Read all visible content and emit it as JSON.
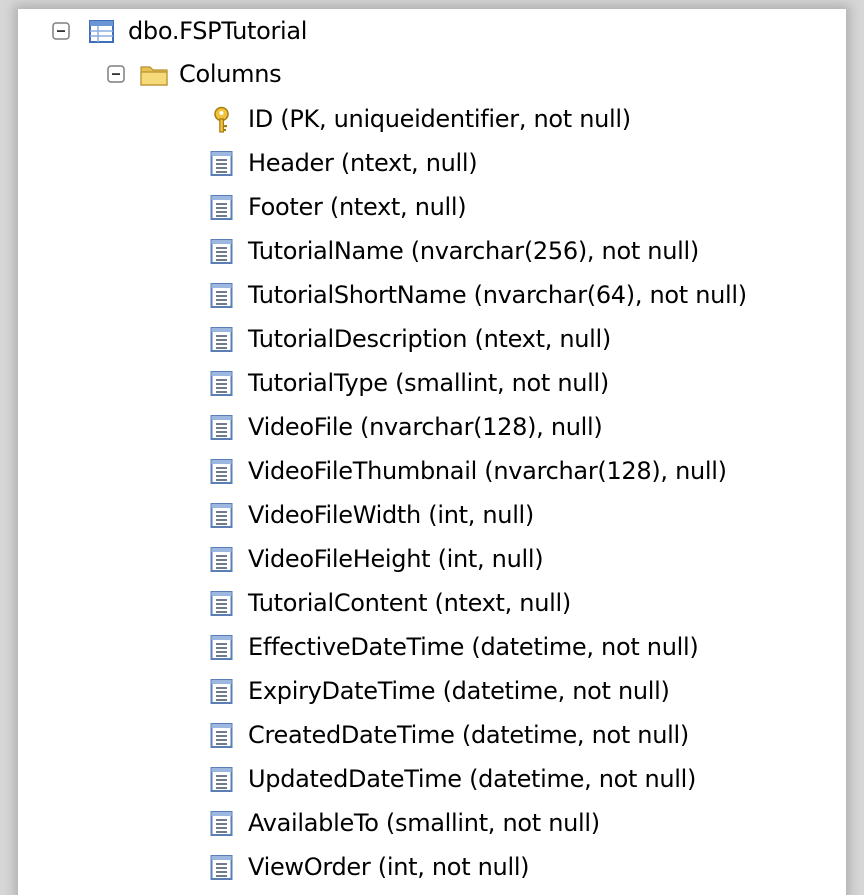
{
  "tree": {
    "table": {
      "label": "dbo.FSPTutorial",
      "icon": "table-icon"
    },
    "columns_folder": {
      "label": "Columns",
      "icon": "folder-icon"
    },
    "columns": [
      {
        "label": "ID (PK, uniqueidentifier, not null)",
        "icon": "key-icon"
      },
      {
        "label": "Header (ntext, null)",
        "icon": "column-icon"
      },
      {
        "label": "Footer (ntext, null)",
        "icon": "column-icon"
      },
      {
        "label": "TutorialName (nvarchar(256), not null)",
        "icon": "column-icon"
      },
      {
        "label": "TutorialShortName (nvarchar(64), not null)",
        "icon": "column-icon"
      },
      {
        "label": "TutorialDescription (ntext, null)",
        "icon": "column-icon"
      },
      {
        "label": "TutorialType (smallint, not null)",
        "icon": "column-icon"
      },
      {
        "label": "VideoFile (nvarchar(128), null)",
        "icon": "column-icon"
      },
      {
        "label": "VideoFileThumbnail (nvarchar(128), null)",
        "icon": "column-icon"
      },
      {
        "label": "VideoFileWidth (int, null)",
        "icon": "column-icon"
      },
      {
        "label": "VideoFileHeight (int, null)",
        "icon": "column-icon"
      },
      {
        "label": "TutorialContent (ntext, null)",
        "icon": "column-icon"
      },
      {
        "label": "EffectiveDateTime (datetime, not null)",
        "icon": "column-icon"
      },
      {
        "label": "ExpiryDateTime (datetime, not null)",
        "icon": "column-icon"
      },
      {
        "label": "CreatedDateTime (datetime, not null)",
        "icon": "column-icon"
      },
      {
        "label": "UpdatedDateTime (datetime, not null)",
        "icon": "column-icon"
      },
      {
        "label": "AvailableTo (smallint, not null)",
        "icon": "column-icon"
      },
      {
        "label": "ViewOrder (int, not null)",
        "icon": "column-icon"
      }
    ]
  }
}
